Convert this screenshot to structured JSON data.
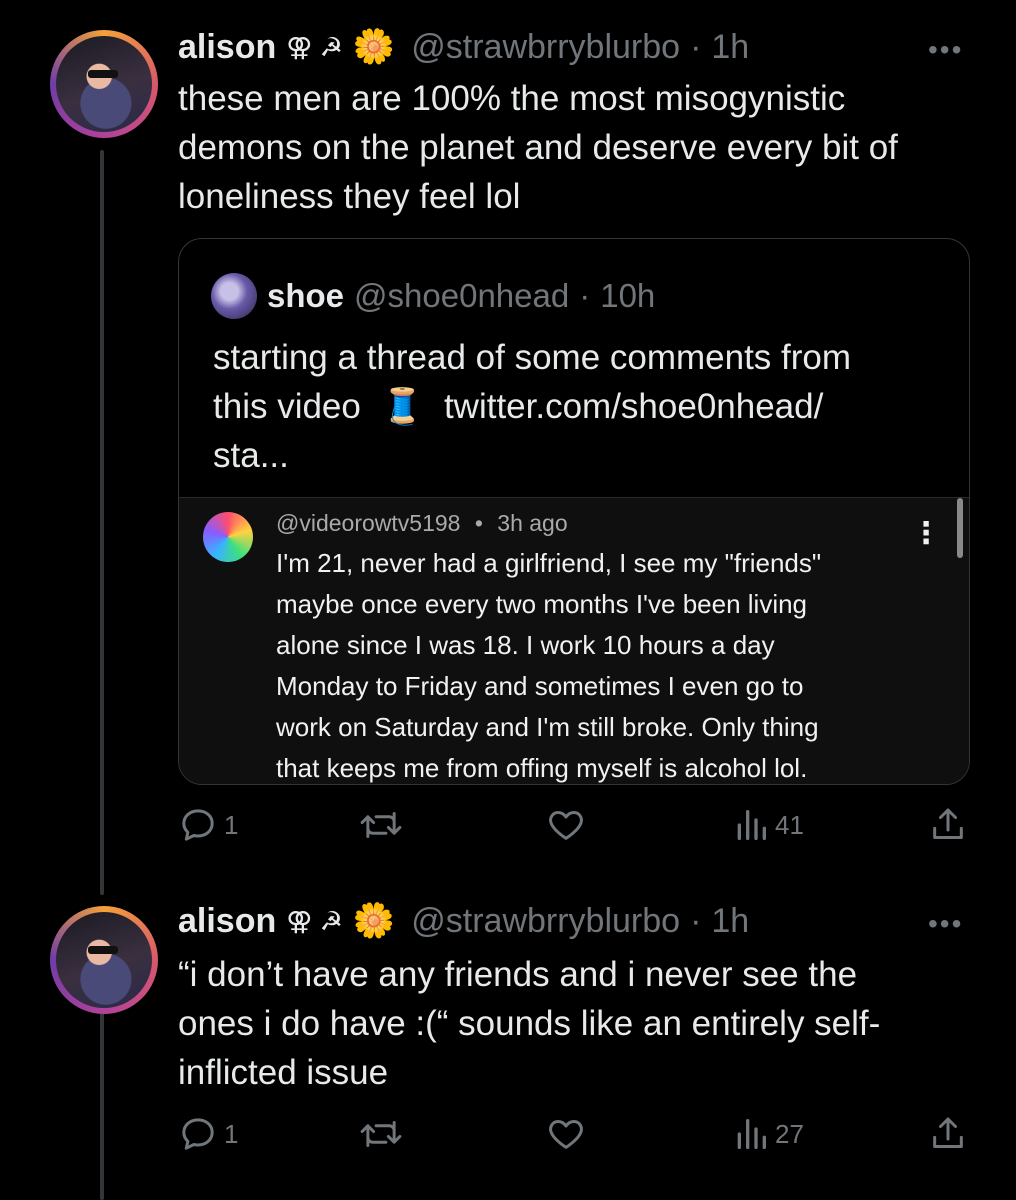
{
  "tweets": [
    {
      "author_name": "alison",
      "author_symbols": "⚢ ☭",
      "author_flower": "🌼",
      "handle": "@strawbrryblurbo",
      "separator": "·",
      "time": "1h",
      "more": "•••",
      "text_lines": [
        "these men are 100% the most misogynistic",
        "demons on the planet and deserve every bit of",
        "loneliness they feel lol"
      ],
      "quote": {
        "name": "shoe",
        "handle": "@shoe0nhead",
        "separator": "·",
        "time": "10h",
        "text_lines": [
          "starting a thread of some comments from",
          "this video",
          "sta..."
        ],
        "link": "twitter.com/shoe0nhead/",
        "link_emoji": "🧵",
        "comment": {
          "handle": "@videorowtv5198",
          "separator": "•",
          "time": "3h ago",
          "more": "⋮",
          "lines": [
            "I'm 21, never had a girlfriend, I see my \"friends\"",
            "maybe once every two months I've been living",
            "alone since I was 18. I work 10 hours a day",
            "Monday to Friday and sometimes I even go to",
            "work on Saturday and I'm still broke. Only thing",
            "that keeps me from offing myself is alcohol lol."
          ]
        }
      },
      "actions": {
        "replies": "1",
        "views": "41"
      }
    },
    {
      "author_name": "alison",
      "author_symbols": "⚢ ☭",
      "author_flower": "🌼",
      "handle": "@strawbrryblurbo",
      "separator": "·",
      "time": "1h",
      "more": "•••",
      "text_lines": [
        "“i don’t have any friends and i never see the",
        "ones i do have :(“ sounds like an entirely self-",
        "inflicted issue"
      ],
      "actions": {
        "replies": "1",
        "views": "27"
      }
    }
  ],
  "colors": {
    "background": "#000000",
    "text": "#e7e9ea",
    "muted": "#71767b",
    "border": "#333639",
    "link": "#e7e9ea"
  }
}
